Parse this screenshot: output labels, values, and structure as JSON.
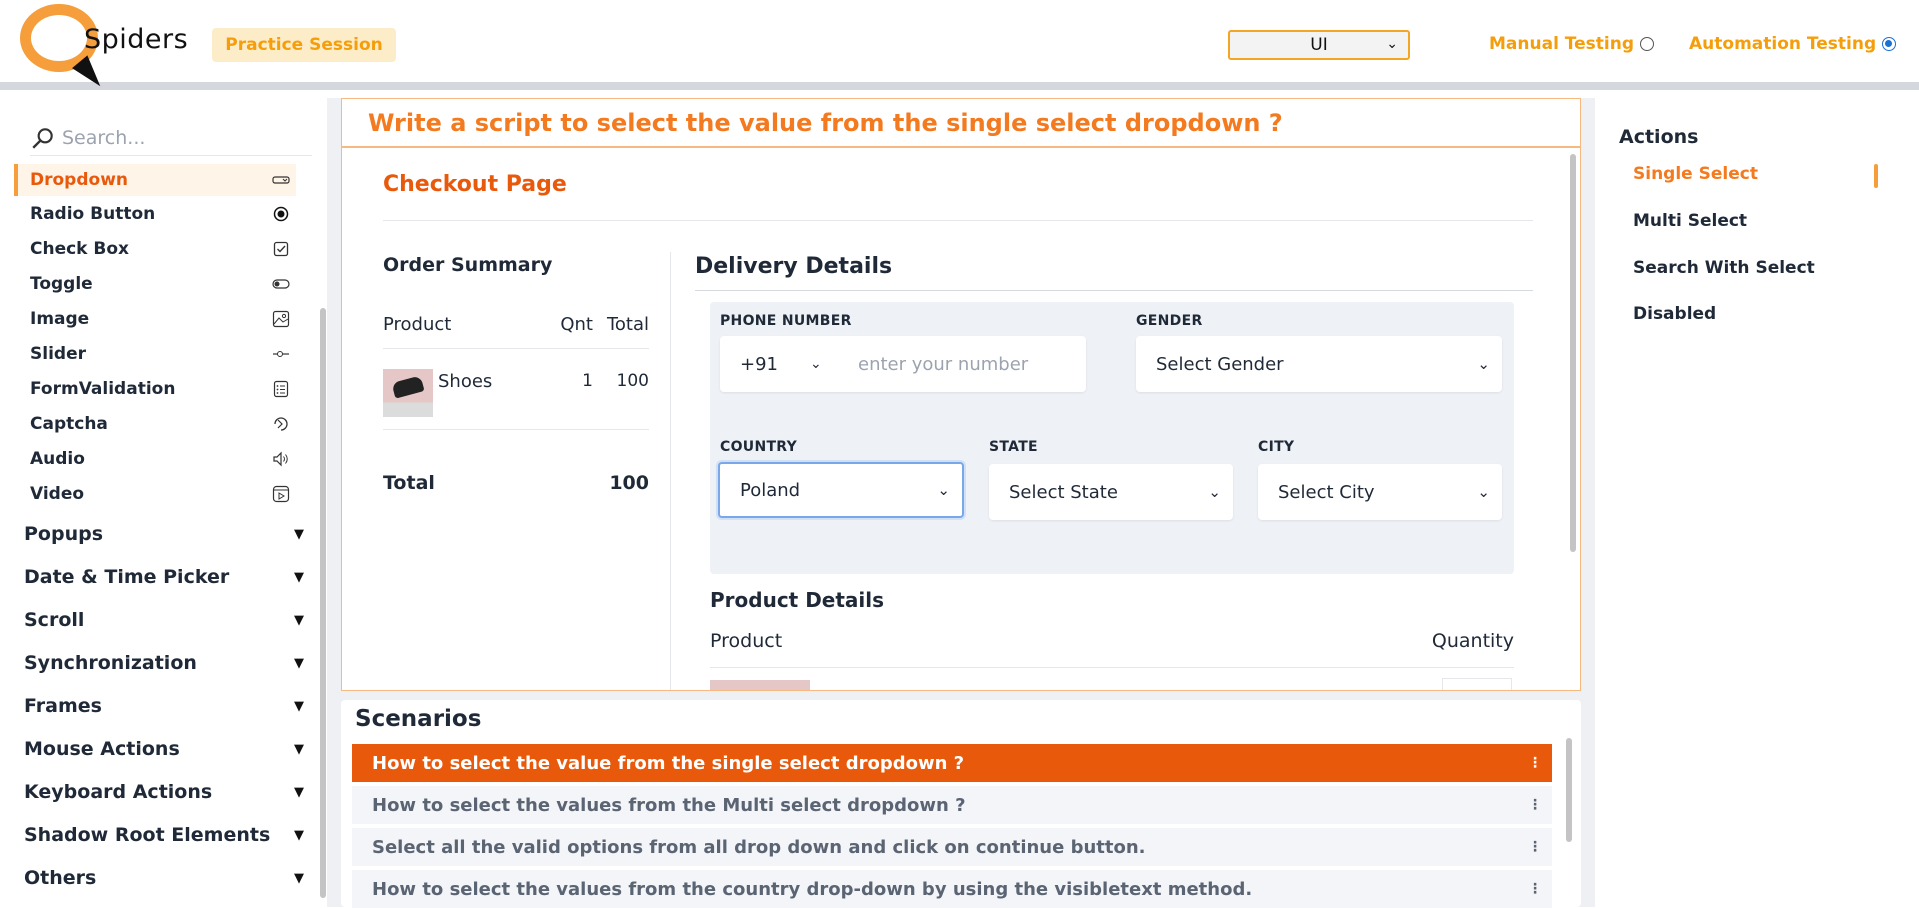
{
  "header": {
    "logo_text": "Spiders",
    "badge": "Practice Session",
    "mode_select": "UI",
    "mode_manual": "Manual Testing",
    "mode_automation": "Automation Testing"
  },
  "sidebar": {
    "search_placeholder": "Search...",
    "items": [
      {
        "label": "Dropdown",
        "icon": "dropdown-icon"
      },
      {
        "label": "Radio Button",
        "icon": "radio-icon"
      },
      {
        "label": "Check Box",
        "icon": "checkbox-icon"
      },
      {
        "label": "Toggle",
        "icon": "toggle-icon"
      },
      {
        "label": "Image",
        "icon": "image-icon"
      },
      {
        "label": "Slider",
        "icon": "slider-icon"
      },
      {
        "label": "FormValidation",
        "icon": "form-icon"
      },
      {
        "label": "Captcha",
        "icon": "captcha-icon"
      },
      {
        "label": "Audio",
        "icon": "audio-icon"
      },
      {
        "label": "Video",
        "icon": "video-icon"
      }
    ],
    "groups": [
      "Popups",
      "Date & Time Picker",
      "Scroll",
      "Synchronization",
      "Frames",
      "Mouse Actions",
      "Keyboard Actions",
      "Shadow Root Elements",
      "Others"
    ]
  },
  "main": {
    "question": "Write a script to select the value from the single select dropdown ?",
    "checkout_title": "Checkout Page",
    "order_summary": {
      "title": "Order Summary",
      "headers": [
        "Product",
        "Qnt",
        "Total"
      ],
      "row": {
        "product": "Shoes",
        "qnt": "1",
        "total": "100"
      },
      "total_label": "Total",
      "total_value": "100"
    },
    "delivery": {
      "title": "Delivery Details",
      "phone_label": "PHONE NUMBER",
      "phone_code": "+91",
      "phone_placeholder": "enter your number",
      "gender_label": "GENDER",
      "gender_value": "Select Gender",
      "country_label": "COUNTRY",
      "country_value": "Poland",
      "state_label": "STATE",
      "state_value": "Select State",
      "city_label": "CITY",
      "city_value": "Select City"
    },
    "product_details": {
      "title": "Product Details",
      "col_product": "Product",
      "col_quantity": "Quantity"
    }
  },
  "scenarios": {
    "title": "Scenarios",
    "items": [
      "How to select the value from the single select dropdown ?",
      "How to select the values from the Multi select dropdown ?",
      "Select all the valid options from all drop down and click on continue button.",
      "How to select the values from the country drop-down by using the visibletext method."
    ]
  },
  "actions": {
    "title": "Actions",
    "items": [
      "Single Select",
      "Multi Select",
      "Search With Select",
      "Disabled"
    ]
  },
  "colors": {
    "accent": "#e8590c",
    "brand": "#f59e3b"
  }
}
